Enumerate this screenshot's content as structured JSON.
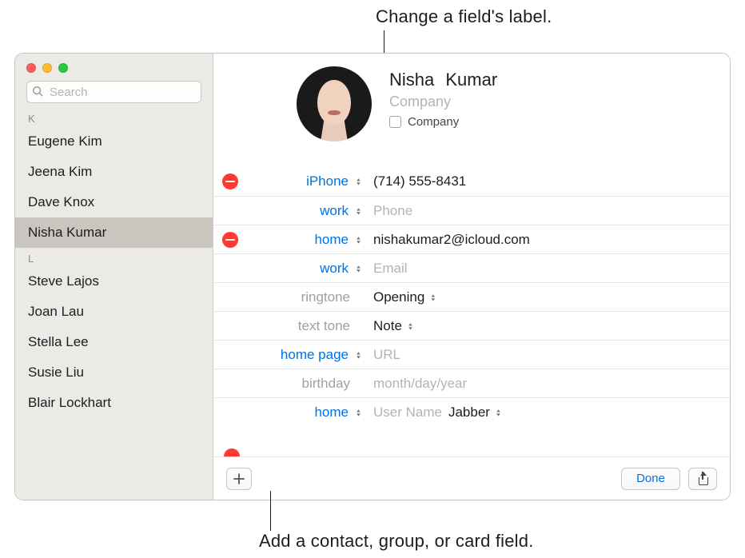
{
  "callouts": {
    "top": "Change a field's label.",
    "bottom": "Add a contact, group, or card field."
  },
  "search": {
    "placeholder": "Search"
  },
  "sections": [
    {
      "letter": "K",
      "contacts": [
        "Eugene Kim",
        "Jeena Kim",
        "Dave Knox",
        "Nisha Kumar"
      ]
    },
    {
      "letter": "L",
      "contacts": [
        "Steve Lajos",
        "Joan Lau",
        "Stella Lee",
        "Susie Liu",
        "Blair Lockhart"
      ]
    }
  ],
  "selected_contact": "Nisha Kumar",
  "card": {
    "first_name": "Nisha",
    "last_name": "Kumar",
    "company_placeholder": "Company",
    "company_checkbox_label": "Company"
  },
  "rows": [
    {
      "remove": true,
      "label": "iPhone",
      "label_style": "blue",
      "label_select": true,
      "value": "(714) 555-8431",
      "value_style": "text"
    },
    {
      "remove": false,
      "label": "work",
      "label_style": "blue",
      "label_select": true,
      "value": "Phone",
      "value_style": "placeholder"
    },
    {
      "remove": true,
      "label": "home",
      "label_style": "blue",
      "label_select": true,
      "value": "nishakumar2@icloud.com",
      "value_style": "text"
    },
    {
      "remove": false,
      "label": "work",
      "label_style": "blue",
      "label_select": true,
      "value": "Email",
      "value_style": "placeholder"
    },
    {
      "remove": false,
      "label": "ringtone",
      "label_style": "gray",
      "label_select": false,
      "dropdown_value": "Opening"
    },
    {
      "remove": false,
      "label": "text tone",
      "label_style": "gray",
      "label_select": false,
      "dropdown_value": "Note"
    },
    {
      "remove": false,
      "label": "home page",
      "label_style": "blue",
      "label_select": true,
      "value": "URL",
      "value_style": "placeholder"
    },
    {
      "remove": false,
      "label": "birthday",
      "label_style": "gray",
      "label_select": false,
      "value": "month/day/year",
      "value_style": "placeholder"
    },
    {
      "remove": false,
      "label": "home",
      "label_style": "blue",
      "label_select": true,
      "value": "User Name",
      "value_style": "placeholder",
      "trailing_dropdown": "Jabber"
    }
  ],
  "buttons": {
    "done": "Done"
  }
}
